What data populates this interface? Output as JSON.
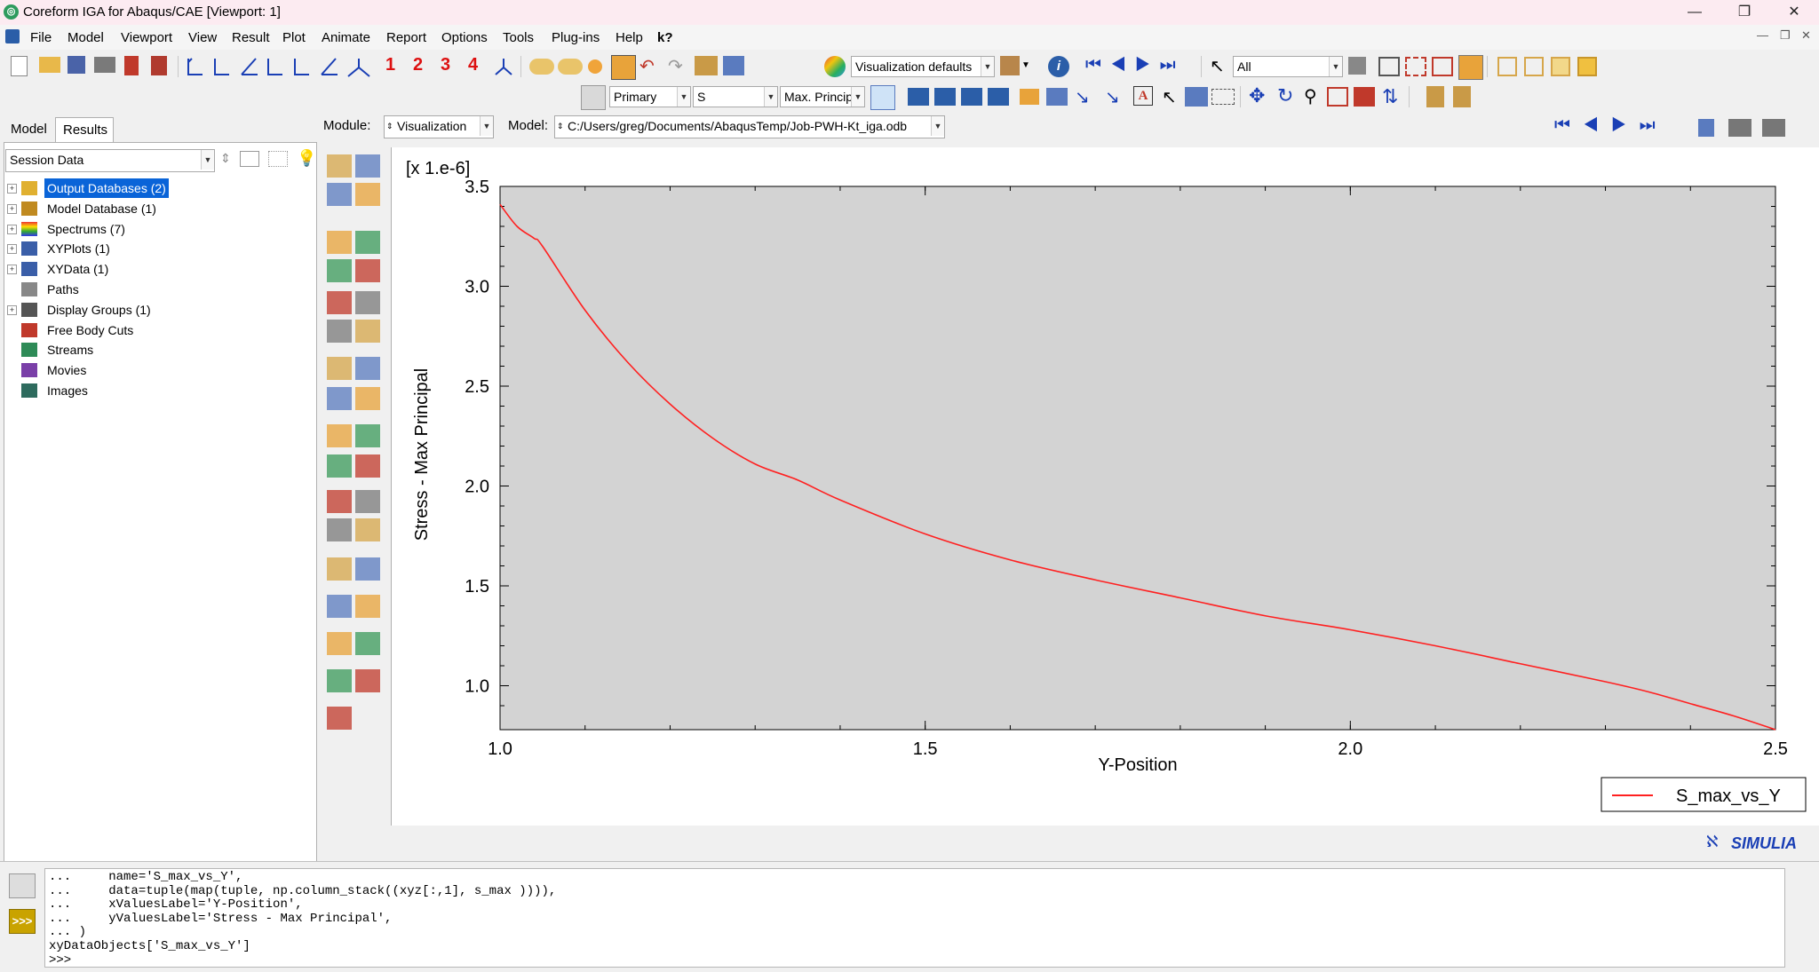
{
  "window": {
    "title": "Coreform IGA for Abaqus/CAE [Viewport: 1]",
    "minimize_glyph": "—",
    "maximize_glyph": "❐",
    "close_glyph": "✕"
  },
  "menu": {
    "items": [
      "File",
      "Model",
      "Viewport",
      "View",
      "Result",
      "Plot",
      "Animate",
      "Report",
      "Options",
      "Tools",
      "Plug-ins",
      "Help"
    ],
    "help_query": "k?"
  },
  "toolbar1": {
    "step_numbers": [
      "1",
      "2",
      "3",
      "4"
    ],
    "visualization_defaults": "Visualization defaults",
    "selection_filter": "All"
  },
  "toolbar2": {
    "output_position": "Primary",
    "field_variable": "S",
    "invariant": "Max. Principal"
  },
  "context": {
    "module_label": "Module:",
    "module_value": "Visualization",
    "model_label": "Model:",
    "model_value": "C:/Users/greg/Documents/AbaqusTemp/Job-PWH-Kt_iga.odb"
  },
  "panel": {
    "tabs": [
      "Model",
      "Results"
    ],
    "active_tab": "Results",
    "dropdown": "Session Data",
    "tree": [
      {
        "label": "Output Databases (2)",
        "expandable": true,
        "selected": true,
        "icon": "database-icon"
      },
      {
        "label": "Model Database (1)",
        "expandable": true,
        "selected": false,
        "icon": "model-database-icon"
      },
      {
        "label": "Spectrums (7)",
        "expandable": true,
        "selected": false,
        "icon": "spectrum-icon"
      },
      {
        "label": "XYPlots (1)",
        "expandable": true,
        "selected": false,
        "icon": "xyplot-icon"
      },
      {
        "label": "XYData (1)",
        "expandable": true,
        "selected": false,
        "icon": "xydata-icon"
      },
      {
        "label": "Paths",
        "expandable": false,
        "selected": false,
        "icon": "path-icon"
      },
      {
        "label": "Display Groups (1)",
        "expandable": true,
        "selected": false,
        "icon": "display-group-icon"
      },
      {
        "label": "Free Body Cuts",
        "expandable": false,
        "selected": false,
        "icon": "free-body-cut-icon"
      },
      {
        "label": "Streams",
        "expandable": false,
        "selected": false,
        "icon": "stream-icon"
      },
      {
        "label": "Movies",
        "expandable": false,
        "selected": false,
        "icon": "movie-icon"
      },
      {
        "label": "Images",
        "expandable": false,
        "selected": false,
        "icon": "image-icon"
      }
    ]
  },
  "chart_data": {
    "type": "line",
    "scale_label": "[x 1.e-6]",
    "xlabel": "Y-Position",
    "ylabel": "Stress - Max Principal",
    "xlim": [
      1.0,
      2.5
    ],
    "ylim": [
      0.78,
      3.5
    ],
    "xticks": [
      "1.0",
      "1.5",
      "2.0",
      "2.5"
    ],
    "yticks": [
      "3.5",
      "3.0",
      "2.5",
      "2.0",
      "1.5",
      "1.0"
    ],
    "legend_position": "bottom-right",
    "grid": false,
    "series": [
      {
        "name": "S_max_vs_Y",
        "color": "#ff2020",
        "x": [
          1.0,
          1.02,
          1.04,
          1.05,
          1.1,
          1.15,
          1.2,
          1.25,
          1.3,
          1.35,
          1.4,
          1.5,
          1.6,
          1.7,
          1.8,
          1.9,
          2.0,
          2.1,
          2.2,
          2.3,
          2.35,
          2.4,
          2.45,
          2.5
        ],
        "y": [
          3.41,
          3.3,
          3.24,
          3.2,
          2.88,
          2.62,
          2.41,
          2.24,
          2.11,
          2.03,
          1.93,
          1.76,
          1.63,
          1.53,
          1.44,
          1.35,
          1.28,
          1.2,
          1.11,
          1.02,
          0.97,
          0.91,
          0.85,
          0.78
        ]
      }
    ]
  },
  "brand": "SIMULIA",
  "console": {
    "lines": [
      "...     name='S_max_vs_Y',",
      "...     data=tuple(map(tuple, np.column_stack((xyz[:,1], s_max )))),",
      "...     xValuesLabel='Y-Position',",
      "...     yValuesLabel='Stress - Max Principal',",
      "... )",
      "xyDataObjects['S_max_vs_Y']",
      ">>>"
    ],
    "prompt_button": ">>>"
  }
}
